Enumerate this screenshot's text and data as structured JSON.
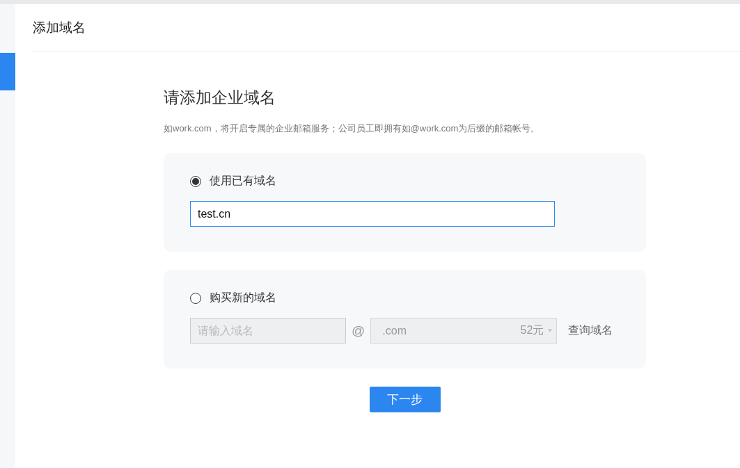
{
  "header": {
    "title": "添加域名"
  },
  "sidebar": {
    "items": [
      {
        "selected": true
      }
    ]
  },
  "heading": "请添加企业域名",
  "description": "如work.com，将开启专属的企业邮箱服务；公司员工即拥有如@work.com为后缀的邮箱帐号。",
  "options": [
    {
      "kind": "existing",
      "label": "使用已有域名",
      "selected": true,
      "value": "test.cn"
    },
    {
      "kind": "buy",
      "label": "购买新的域名",
      "selected": false,
      "placeholder": "请输入域名",
      "at": "@",
      "suffix": ".com",
      "price": "52元",
      "query": "查询域名"
    }
  ],
  "next_button": "下一步"
}
